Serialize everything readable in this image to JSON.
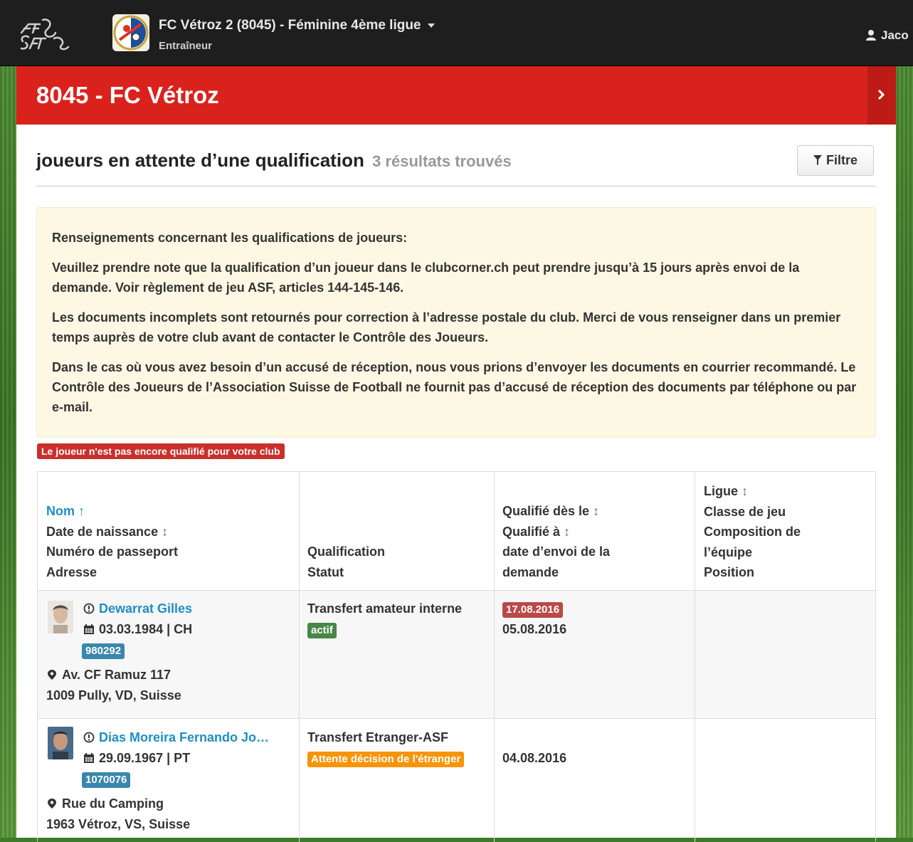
{
  "header": {
    "team_title": "FC Vétroz 2 (8045) - Féminine 4ème ligue",
    "role": "Entraîneur",
    "user_name": "Jaco"
  },
  "club": {
    "title": "8045 - FC Vétroz"
  },
  "section": {
    "title": "joueurs en attente d’une qualification",
    "count": "3 résultats trouvés",
    "filter_label": "Filtre"
  },
  "info": {
    "heading": "Renseignements concernant les qualifications de joueurs:",
    "p1": "Veuillez prendre note que la qualification d’un joueur dans le clubcorner.ch peut prendre jusqu’à 15 jours après envoi de la demande. Voir règlement de jeu ASF, articles 144-145-146.",
    "p2": "Les documents incomplets sont retournés pour correction à l’adresse postale du club. Merci de vous renseigner dans un premier temps auprès de votre club avant de contacter le Contrôle des Joueurs.",
    "p3": "Dans le cas où vous avez besoin d’un accusé de réception, nous vous prions d’envoyer les documents en courrier recommandé. Le Contrôle des Joueurs de l’Association Suisse de Football ne fournit pas d’accusé de réception des documents par téléphone ou par e-mail."
  },
  "legend": {
    "not_qualified": "Le joueur n'est pas encore qualifié pour votre club"
  },
  "table": {
    "headers": {
      "nom": "Nom",
      "nom_sort": "↑",
      "dob": "Date de naissance",
      "dob_sort": "↕",
      "passport": "Numéro de passeport",
      "address": "Adresse",
      "qualification": "Qualification",
      "status": "Statut",
      "qual_from": "Qualifié dès le",
      "qual_from_sort": "↕",
      "qual_to": "Qualifié à",
      "qual_to_sort": "↕",
      "sent_date_1": "date d’envoi de la",
      "sent_date_2": "demande",
      "league": "Ligue",
      "league_sort": "↕",
      "class": "Classe de jeu",
      "composition_1": "Composition de",
      "composition_2": "l’équipe",
      "position": "Position"
    },
    "rows": [
      {
        "name": "Dewarrat Gilles",
        "dob": "03.03.1984 | CH",
        "passport": "980292",
        "street": "Av. CF Ramuz 117",
        "city": "1009 Pully, VD, Suisse",
        "qualification": "Transfert amateur interne",
        "status": "actif",
        "qual_from": "17.08.2016",
        "sent_date": "05.08.2016"
      },
      {
        "name": "Dias Moreira Fernando Jo…",
        "dob": "29.09.1967 | PT",
        "passport": "1070076",
        "street": "Rue du Camping",
        "city": "1963 Vétroz, VS, Suisse",
        "qualification": "Transfert Etranger-ASF",
        "status": "Attente décision de l'étranger",
        "sent_date": "04.08.2016"
      }
    ]
  }
}
